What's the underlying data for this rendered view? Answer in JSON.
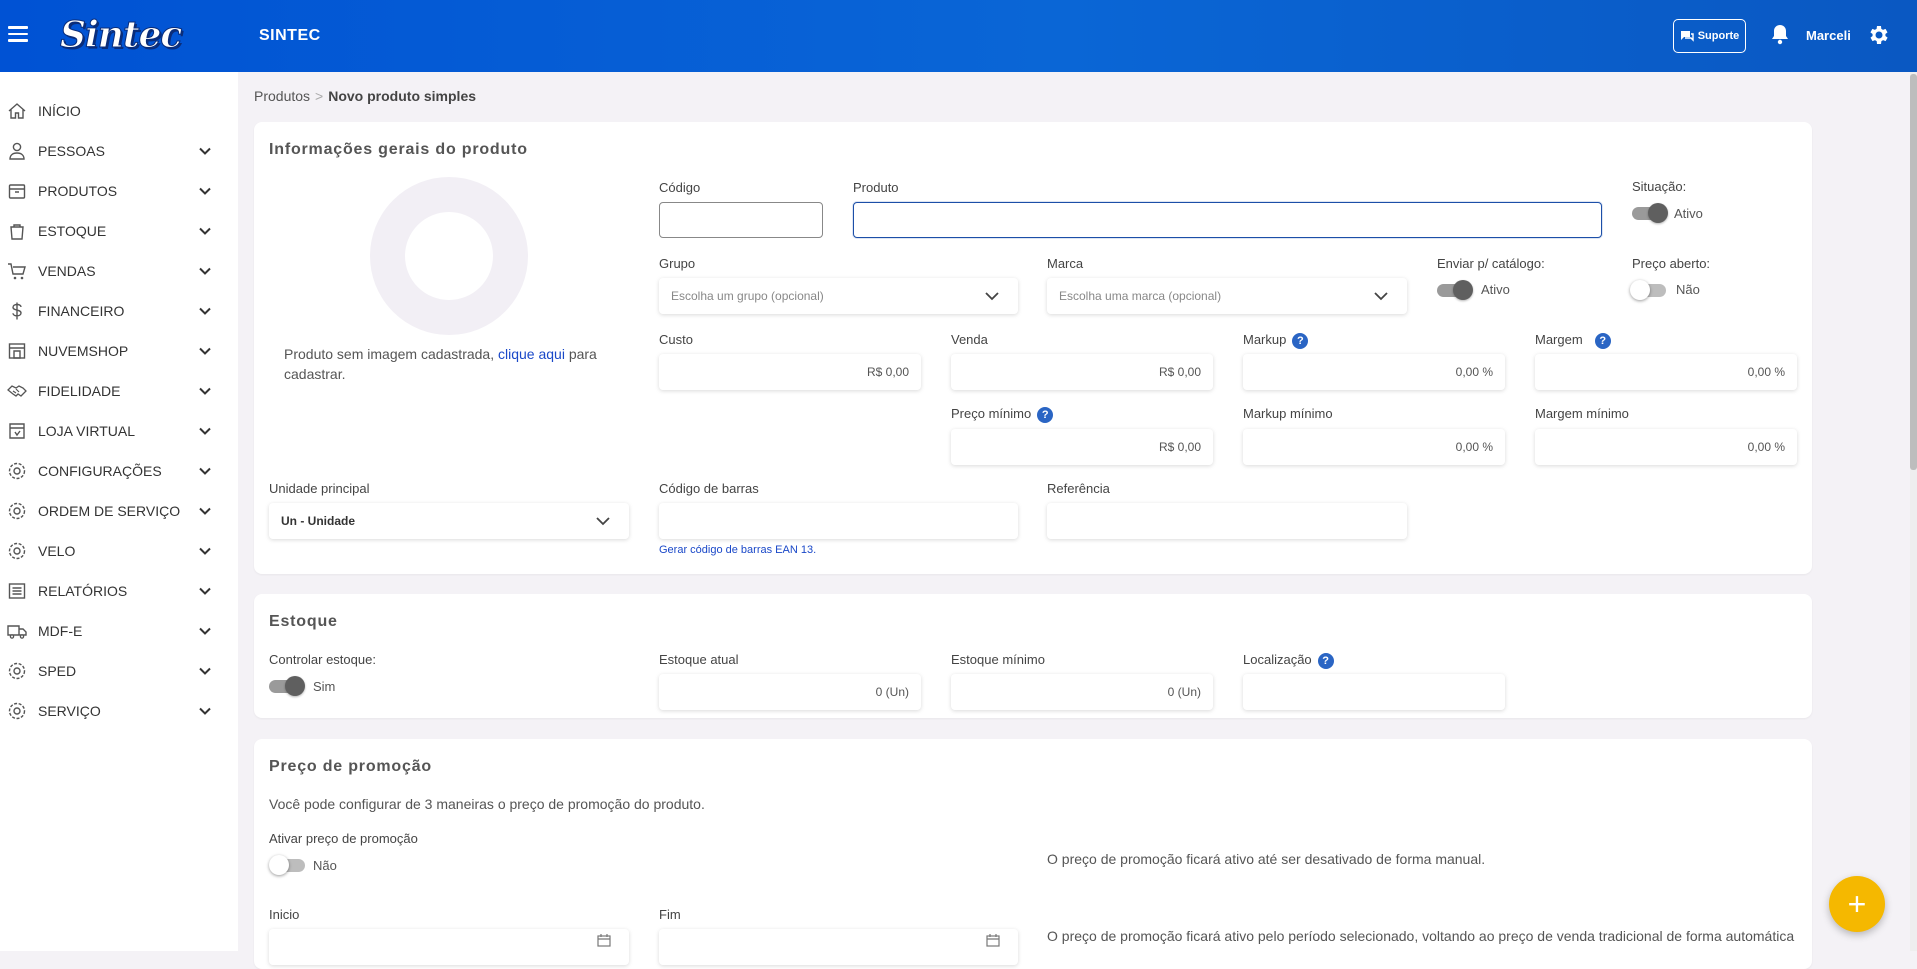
{
  "header": {
    "logo_text": "Sintec",
    "app_name": "SINTEC",
    "support_label": "Suporte",
    "user_name": "Marceli"
  },
  "sidebar": {
    "items": [
      {
        "label": "INÍCIO",
        "icon": "home-icon",
        "expandable": false
      },
      {
        "label": "PESSOAS",
        "icon": "person-icon",
        "expandable": true
      },
      {
        "label": "PRODUTOS",
        "icon": "box-icon",
        "expandable": true
      },
      {
        "label": "ESTOQUE",
        "icon": "bag-icon",
        "expandable": true
      },
      {
        "label": "VENDAS",
        "icon": "cart-icon",
        "expandable": true
      },
      {
        "label": "FINANCEIRO",
        "icon": "dollar-icon",
        "expandable": true
      },
      {
        "label": "NUVEMSHOP",
        "icon": "store-icon",
        "expandable": true
      },
      {
        "label": "FIDELIDADE",
        "icon": "handshake-icon",
        "expandable": true
      },
      {
        "label": "LOJA VIRTUAL",
        "icon": "shop-icon",
        "expandable": true
      },
      {
        "label": "CONFIGURAÇÕES",
        "icon": "settings-icon",
        "expandable": true
      },
      {
        "label": "ORDEM DE SERVIÇO",
        "icon": "settings-icon",
        "expandable": true
      },
      {
        "label": "VELO",
        "icon": "settings-icon",
        "expandable": true
      },
      {
        "label": "RELATÓRIOS",
        "icon": "list-icon",
        "expandable": true
      },
      {
        "label": "MDF-E",
        "icon": "truck-icon",
        "expandable": true
      },
      {
        "label": "SPED",
        "icon": "settings-icon",
        "expandable": true
      },
      {
        "label": "SERVIÇO",
        "icon": "settings-icon",
        "expandable": true
      }
    ]
  },
  "breadcrumb": {
    "parent": "Produtos",
    "separator": ">",
    "current": "Novo produto simples"
  },
  "general": {
    "title": "Informações gerais do produto",
    "no_image_text_1": "Produto sem imagem cadastrada, ",
    "no_image_link": "clique aqui",
    "no_image_text_2": " para cadastrar.",
    "codigo_label": "Código",
    "codigo_value": "",
    "produto_label": "Produto",
    "produto_value": "",
    "situacao_label": "Situação:",
    "situacao_value": "Ativo",
    "grupo_label": "Grupo",
    "grupo_placeholder": "Escolha um grupo (opcional)",
    "marca_label": "Marca",
    "marca_placeholder": "Escolha uma marca (opcional)",
    "catalogo_label": "Enviar p/ catálogo:",
    "catalogo_value": "Ativo",
    "preco_aberto_label": "Preço aberto:",
    "preco_aberto_value": "Não",
    "custo_label": "Custo",
    "custo_value": "R$ 0,00",
    "venda_label": "Venda",
    "venda_value": "R$ 0,00",
    "markup_label": "Markup",
    "markup_value": "0,00 %",
    "margem_label": "Margem",
    "margem_value": "0,00 %",
    "preco_minimo_label": "Preço mínimo",
    "preco_minimo_value": "R$ 0,00",
    "markup_minimo_label": "Markup mínimo",
    "markup_minimo_value": "0,00 %",
    "margem_minimo_label": "Margem mínimo",
    "margem_minimo_value": "0,00 %",
    "unidade_label": "Unidade principal",
    "unidade_value": "Un - Unidade",
    "barras_label": "Código de barras",
    "barras_value": "",
    "barras_link": "Gerar código de barras EAN 13.",
    "referencia_label": "Referência",
    "referencia_value": ""
  },
  "stock": {
    "title": "Estoque",
    "controlar_label": "Controlar estoque:",
    "controlar_value": "Sim",
    "atual_label": "Estoque atual",
    "atual_value": "0 (Un)",
    "minimo_label": "Estoque mínimo",
    "minimo_value": "0 (Un)",
    "localizacao_label": "Localização",
    "localizacao_value": ""
  },
  "promo": {
    "title": "Preço de promoção",
    "description": "Você pode configurar de 3 maneiras o preço de promoção do produto.",
    "ativar_label": "Ativar preço de promoção",
    "ativar_value": "Não",
    "manual_text": "O preço de promoção ficará ativo até ser desativado de forma manual.",
    "inicio_label": "Inicio",
    "fim_label": "Fim",
    "periodo_text": "O preço de promoção ficará ativo pelo período selecionado, voltando ao preço de venda tradicional de forma automática"
  },
  "fab_symbol": "+",
  "colors": {
    "header_blue": "#0052d4",
    "link_blue": "#1a48c8",
    "help_blue": "#2a65c4",
    "fab_yellow": "#f5b800"
  }
}
